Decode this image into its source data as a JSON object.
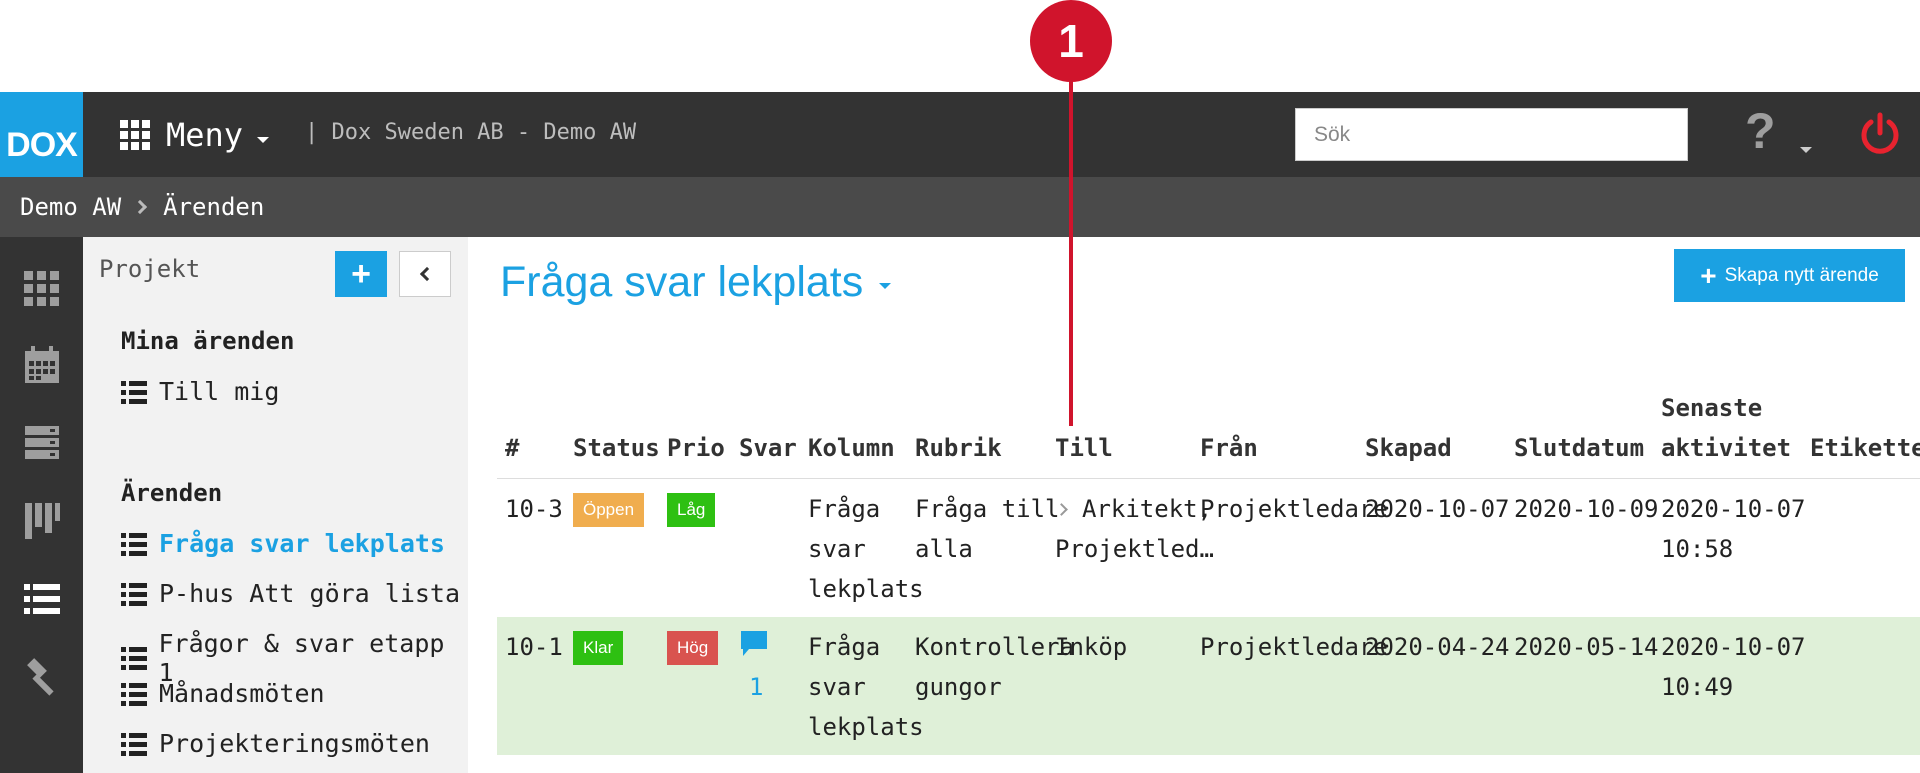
{
  "annotation": {
    "number": "1"
  },
  "topbar": {
    "logo": "DOX",
    "menu_label": "Meny",
    "company": "| Dox Sweden AB - Demo AW",
    "search_placeholder": "Sök",
    "help_label": "?"
  },
  "breadcrumb": {
    "project": "Demo AW",
    "section": "Ärenden"
  },
  "rail": {
    "icons": [
      "apps-icon",
      "calendar-icon",
      "server-icon",
      "kanban-icon",
      "list-icon",
      "hammer-icon"
    ]
  },
  "sidebar": {
    "title": "Projekt",
    "add_label": "+",
    "mina_heading": "Mina ärenden",
    "mina_items": [
      {
        "label": "Till mig"
      }
    ],
    "arenden_heading": "Ärenden",
    "arenden_items": [
      {
        "label": "Fråga svar lekplats",
        "active": true
      },
      {
        "label": "P-hus Att göra lista"
      },
      {
        "label": "Frågor & svar etapp 1"
      },
      {
        "label": "Månadsmöten"
      },
      {
        "label": "Projekteringsmöten"
      }
    ]
  },
  "main": {
    "title": "Fråga svar lekplats",
    "create_label": "Skapa nytt ärende",
    "columns": [
      "#",
      "Status",
      "Prio",
      "Svar",
      "Kolumn",
      "Rubrik",
      "Till",
      "Från",
      "Skapad",
      "Slutdatum",
      "Senaste",
      "aktivitet",
      "Etiketter"
    ],
    "rows": [
      {
        "id": "10-3",
        "status": "Öppen",
        "prio": "Låg",
        "svar": "",
        "kolumn": [
          "Fråga",
          "svar",
          "lekplats"
        ],
        "rubrik": [
          "Fråga till",
          "alla"
        ],
        "till": [
          "Arkitekt,",
          "Projektled…"
        ],
        "fran": "Projektledare",
        "skapad": "2020-10-07",
        "slutdatum": "2020-10-09",
        "senaste": [
          "2020-10-07",
          "10:58"
        ]
      },
      {
        "id": "10-1",
        "status": "Klar",
        "prio": "Hög",
        "svar": "1",
        "kolumn": [
          "Fråga",
          "svar",
          "lekplats"
        ],
        "rubrik": [
          "Kontrollera",
          "gungor"
        ],
        "till": [
          "Inköp"
        ],
        "fran": "Projektledare",
        "skapad": "2020-04-24",
        "slutdatum": "2020-05-14",
        "senaste": [
          "2020-10-07",
          "10:49"
        ]
      }
    ]
  },
  "colors": {
    "accent": "#1ba1e2",
    "topbar": "#333333",
    "open": "#f0ad4e",
    "low": "#2ec012",
    "high": "#d9534f",
    "done": "#dff0d8",
    "annotation": "#d0142c"
  }
}
